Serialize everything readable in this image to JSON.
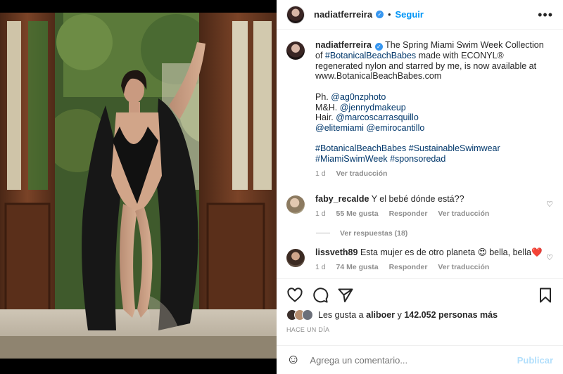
{
  "header": {
    "username": "nadiatferreira",
    "verified_glyph": "✓",
    "separator": "•",
    "follow_label": "Seguir",
    "more_label": "•••"
  },
  "caption": {
    "username": "nadiatferreira",
    "verified_glyph": "✓",
    "text_intro": "The Spring Miami Swim Week Collection of",
    "hashtag_botanical": "#BotanicalBeachBabes",
    "text_mid": "made with ECONYL® regenerated nylon and starred by me, is now available at www.BotanicalBeachBabes.com",
    "ph_label": "Ph.",
    "ph_handle": "@ag0nzphoto",
    "mh_label": "M&H.",
    "mh_handle": "@jennydmakeup",
    "hair_label": "Hair.",
    "hair_handle": "@marcoscarrasquillo",
    "handle_elite": "@elitemiami",
    "handle_emiro": "@emirocantillo",
    "tag1": "#BotanicalBeachBabes",
    "tag2": "#SustainableSwimwear",
    "tag3": "#MiamiSwimWeek",
    "tag4": "#sponsoredad",
    "time": "1 d",
    "translate": "Ver traducción"
  },
  "comments": [
    {
      "username": "faby_recalde",
      "text": "Y el bebé dónde está??",
      "time": "1 d",
      "likes": "55 Me gusta",
      "reply": "Responder",
      "translate": "Ver traducción",
      "view_replies": "Ver respuestas (18)"
    },
    {
      "username": "lissveth89",
      "text": "Esta mujer es de otro planeta 😍 bella, bella❤️",
      "time": "1 d",
      "likes": "74 Me gusta",
      "reply": "Responder",
      "translate": "Ver traducción"
    }
  ],
  "likes": {
    "prefix": "Les gusta a",
    "user": "aliboer",
    "connector": "y",
    "count": "142.052 personas más"
  },
  "posted_ago": "HACE UN DÍA",
  "add_comment": {
    "emoji_glyph": "☺",
    "placeholder": "Agrega un comentario...",
    "post_label": "Publicar"
  },
  "colors": {
    "link": "#00376b",
    "follow": "#0095f6",
    "muted": "#8e8e8e",
    "post_disabled": "#b2dffc",
    "like_heart": "#ed4956"
  }
}
